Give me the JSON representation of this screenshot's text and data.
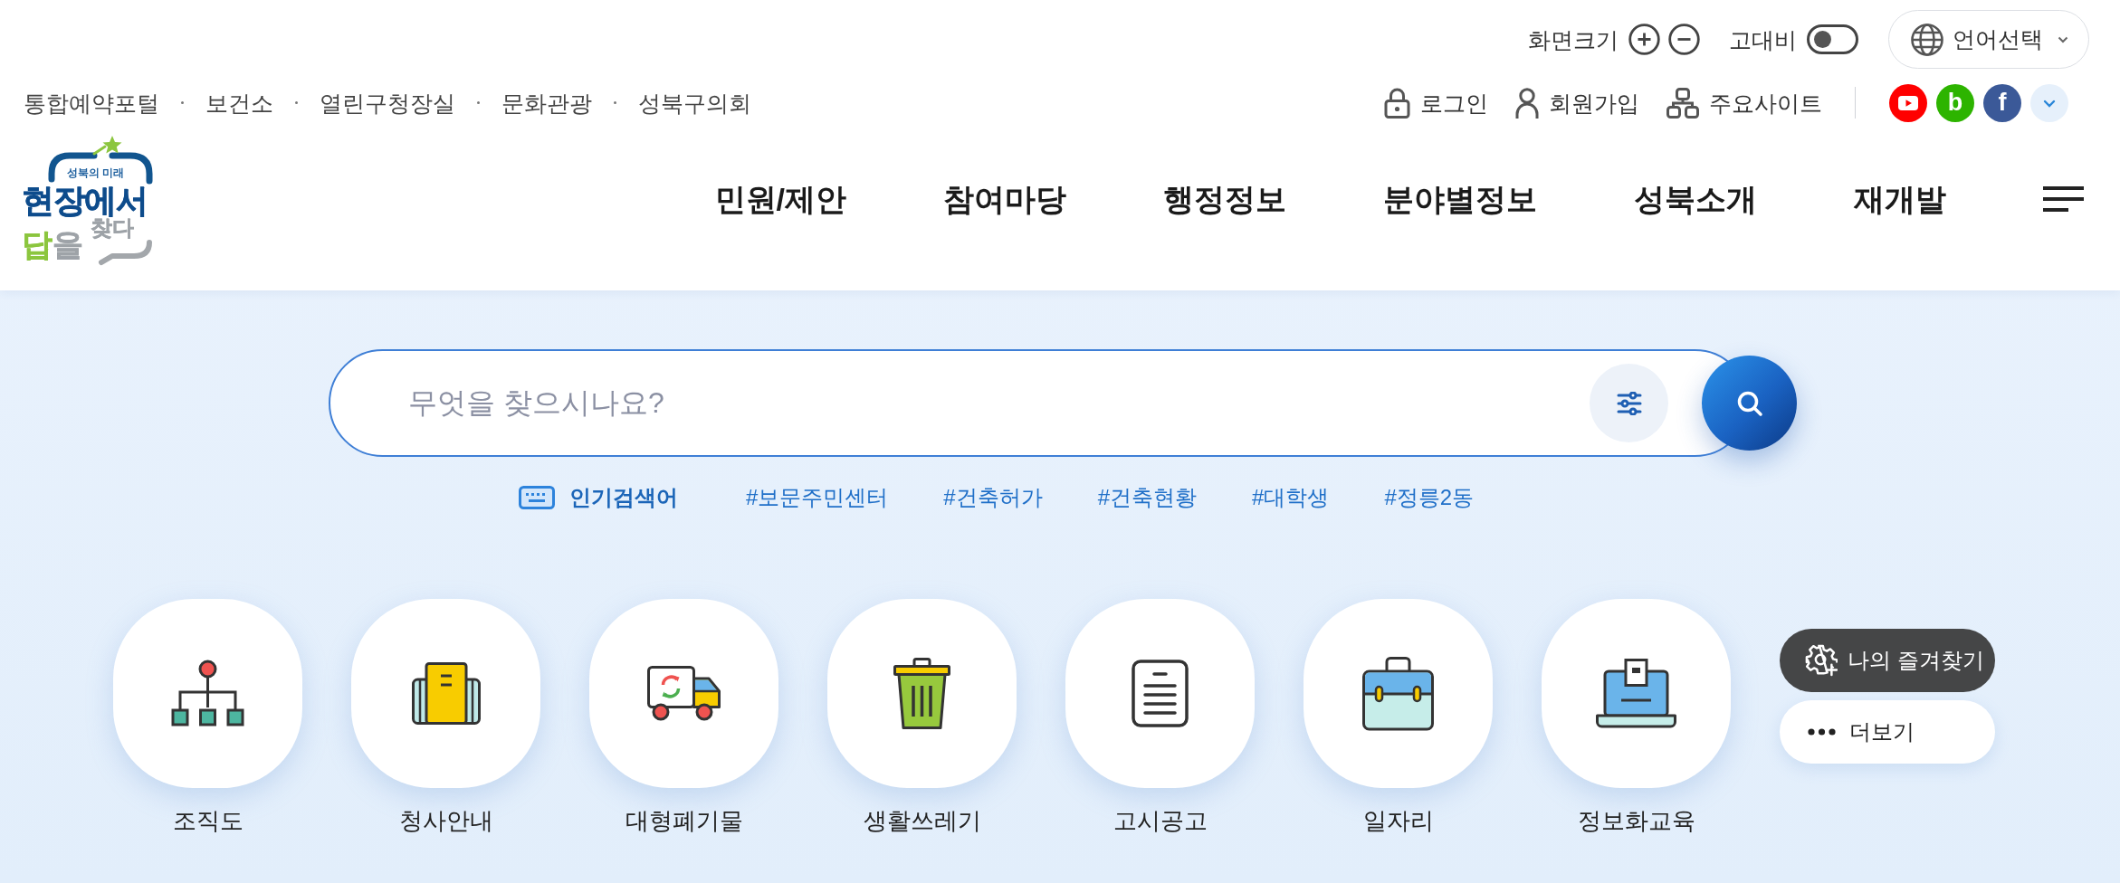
{
  "utility": {
    "font_size_label": "화면크기",
    "high_contrast": {
      "label": "고대비",
      "on": false
    },
    "language": {
      "label": "언어선택"
    }
  },
  "family_links": [
    "통합예약포털",
    "보건소",
    "열린구청장실",
    "문화관광",
    "성북구의회"
  ],
  "account_links": [
    {
      "label": "로그인"
    },
    {
      "label": "회원가입"
    },
    {
      "label": "주요사이트"
    }
  ],
  "social_links": [
    {
      "kind": "play",
      "color": "#ff0000"
    },
    {
      "kind": "letter",
      "glyph": "b",
      "color": "#2db400"
    },
    {
      "kind": "letter",
      "glyph": "f",
      "color": "#3b5998"
    }
  ],
  "logo": {
    "tagline": "성북의 미래",
    "headline": "현장에서",
    "answer_highlight": "답",
    "answer_rest": "을",
    "verb": "찾다"
  },
  "nav": {
    "items": [
      "민원/제안",
      "참여마당",
      "행정정보",
      "분야별정보",
      "성북소개",
      "재개발"
    ]
  },
  "search": {
    "placeholder": "무엇을 찾으시나요?"
  },
  "popular": {
    "label": "인기검색어",
    "tags": [
      "#보문주민센터",
      "#건축허가",
      "#건축현황",
      "#대학생",
      "#정릉2동"
    ]
  },
  "quick_menu": [
    {
      "label": "조직도"
    },
    {
      "label": "청사안내"
    },
    {
      "label": "대형폐기물"
    },
    {
      "label": "생활쓰레기"
    },
    {
      "label": "고시공고"
    },
    {
      "label": "일자리"
    },
    {
      "label": "정보화교육"
    }
  ],
  "favorites": {
    "label": "나의 즐겨찾기"
  },
  "more": {
    "label": "더보기"
  }
}
